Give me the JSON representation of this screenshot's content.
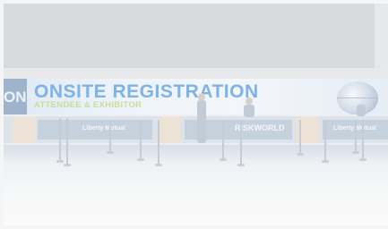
{
  "scene": {
    "banner": {
      "left_text": "ON",
      "title": "ONSITE REGISTRATION",
      "subtitle": "ATTENDEE & EXHIBITOR"
    },
    "desk_panels": [
      {
        "text": "Liberty Mutual"
      },
      {
        "text": "RISKWORLD"
      },
      {
        "text": "Liberty Mutual"
      }
    ]
  }
}
